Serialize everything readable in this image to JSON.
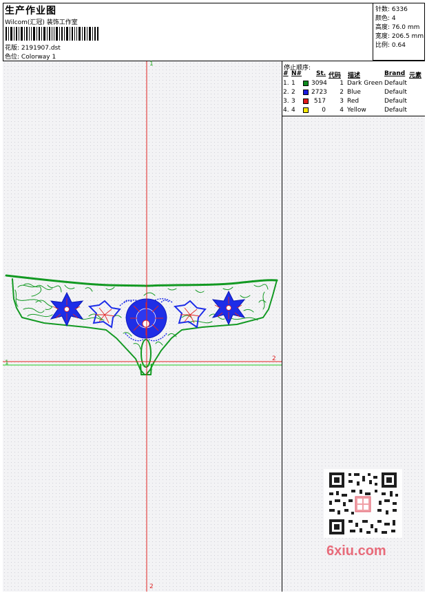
{
  "header": {
    "title": "生产作业图",
    "company": "Wilcom(汇冠) 装饰工作室",
    "design_label": "花版:",
    "design_file": "2191907.dst",
    "colorway_label": "色位:",
    "colorway": "Colorway 1"
  },
  "stats": {
    "stitches_label": "针数:",
    "stitches": "6336",
    "colors_label": "颜色:",
    "colors": "4",
    "height_label": "高度:",
    "height": "76.0 mm",
    "width_label": "宽度:",
    "width": "206.5 mm",
    "scale_label": "比例:",
    "scale": "0.64"
  },
  "stop_sequence": {
    "title": "停止顺序:",
    "columns": [
      "#",
      "N#",
      "St.",
      "代码",
      "描述",
      "Brand",
      "元素"
    ],
    "rows": [
      {
        "idx": "1.",
        "n": "1",
        "st": "3094",
        "code": "1",
        "desc": "Dark Green",
        "brand": "Default",
        "color": "#0e8a1e"
      },
      {
        "idx": "2.",
        "n": "2",
        "st": "2723",
        "code": "2",
        "desc": "Blue",
        "brand": "Default",
        "color": "#1a1ae0"
      },
      {
        "idx": "3.",
        "n": "3",
        "st": "517",
        "code": "3",
        "desc": "Red",
        "brand": "Default",
        "color": "#e01818"
      },
      {
        "idx": "4.",
        "n": "4",
        "st": "0",
        "code": "4",
        "desc": "Yellow",
        "brand": "Default",
        "color": "#f5e800"
      }
    ]
  },
  "axes": {
    "top": "1",
    "bottom": "2",
    "left": "1",
    "right": "2"
  },
  "watermark": {
    "text": "6xiu.com"
  }
}
